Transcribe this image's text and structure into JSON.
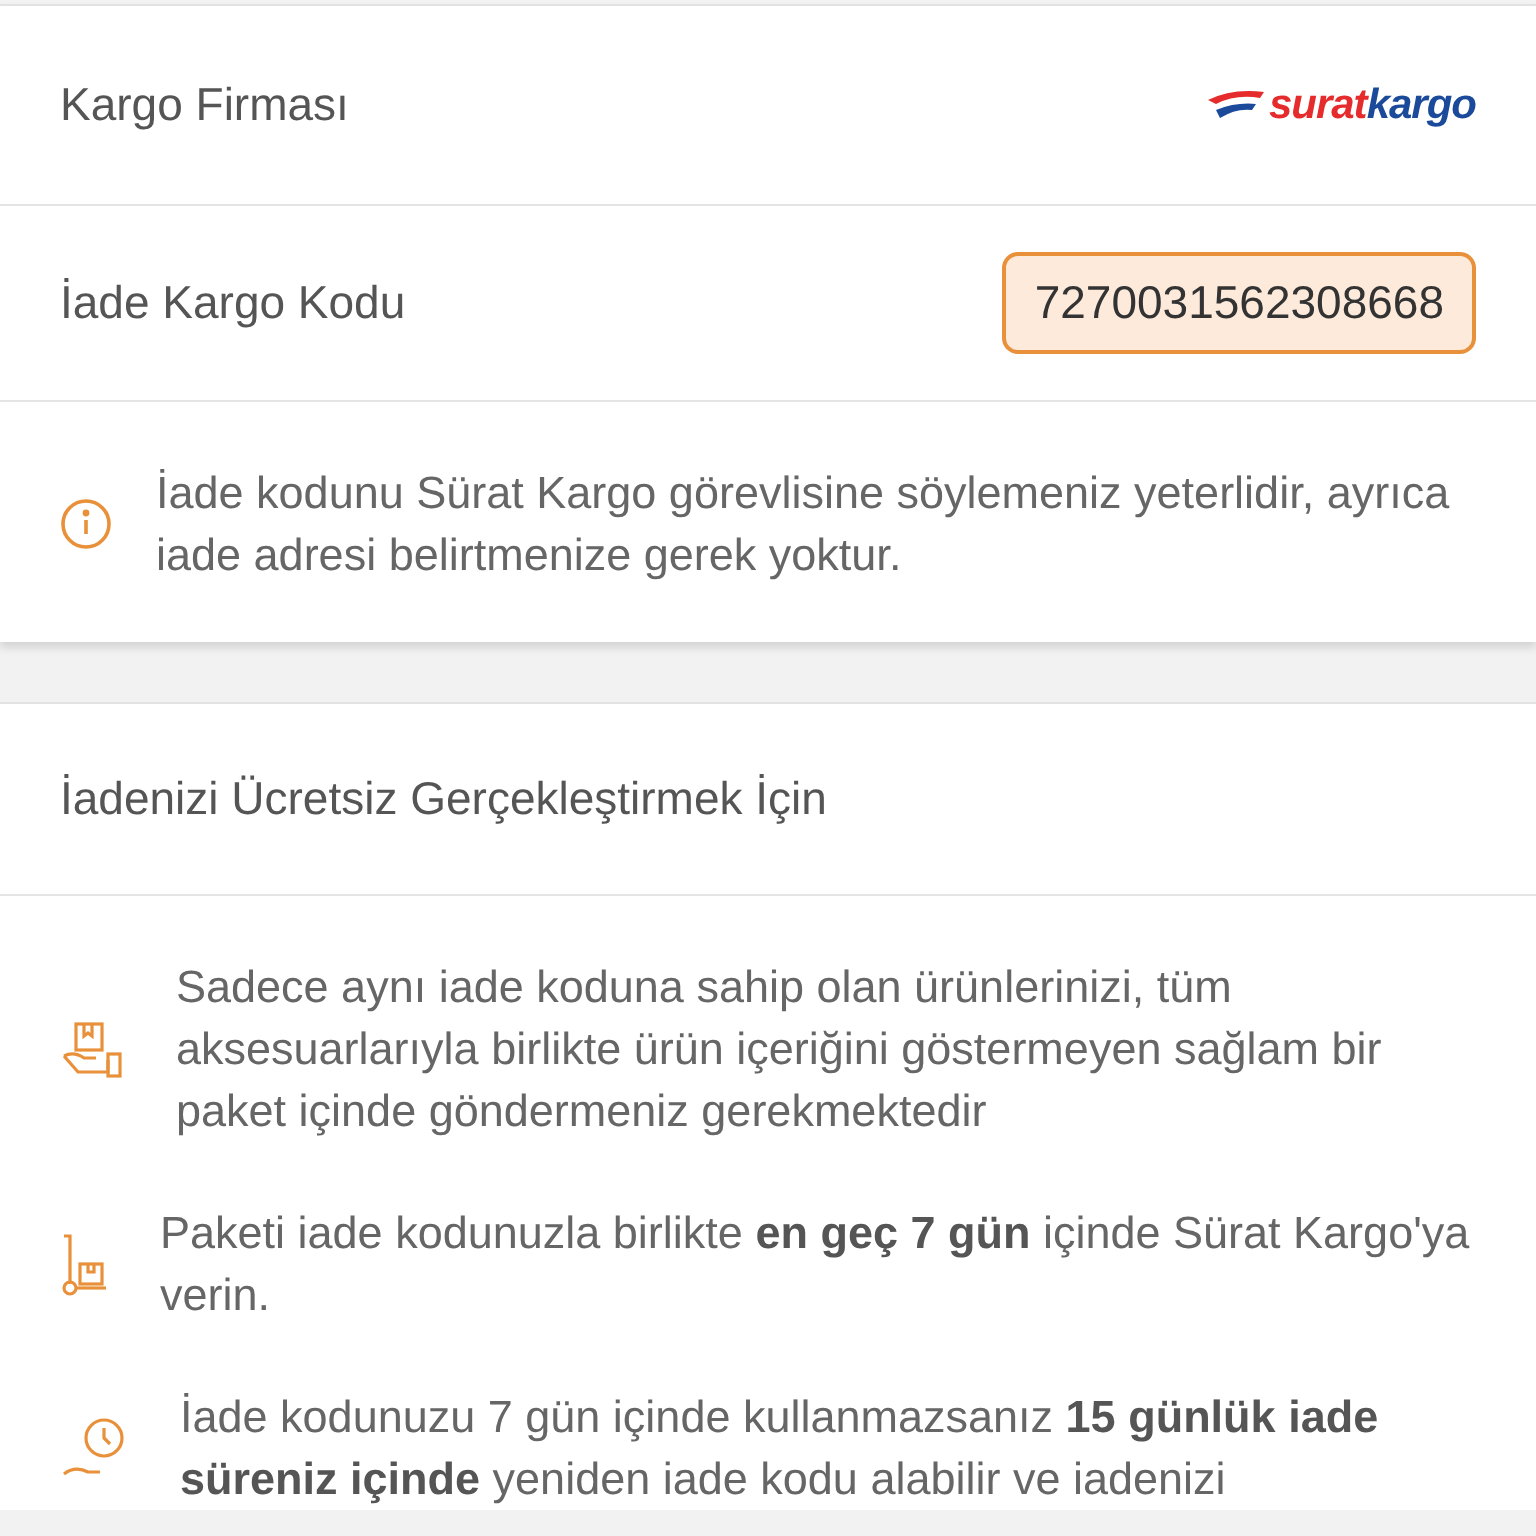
{
  "shipping": {
    "company_label": "Kargo Firması",
    "logo": {
      "first": "surat",
      "second": "kargo"
    },
    "code_label": "İade Kargo Kodu",
    "code": "7270031562308668",
    "info": "İade kodunu Sürat Kargo görevlisine söylemeniz yeterlidir, ayrıca iade adresi belirtmenize gerek yoktur."
  },
  "free_return": {
    "title": "İadenizi Ücretsiz Gerçekleştirmek İçin",
    "steps": [
      {
        "kind": "package",
        "text": "Sadece aynı iade koduna sahip olan ürünlerinizi, tüm aksesuarlarıyla birlikte ürün içeriğini göstermeyen sağlam bir paket içinde göndermeniz gerekmektedir"
      },
      {
        "kind": "trolley",
        "text": "Paketi iade kodunuzla birlikte **en geç 7 gün** içinde Sürat Kargo'ya verin."
      },
      {
        "kind": "clock",
        "text": "İade kodunuzu 7 gün içinde kullanmazsanız **15 günlük iade süreniz içinde** yeniden iade kodu alabilir ve iadenizi"
      }
    ]
  }
}
